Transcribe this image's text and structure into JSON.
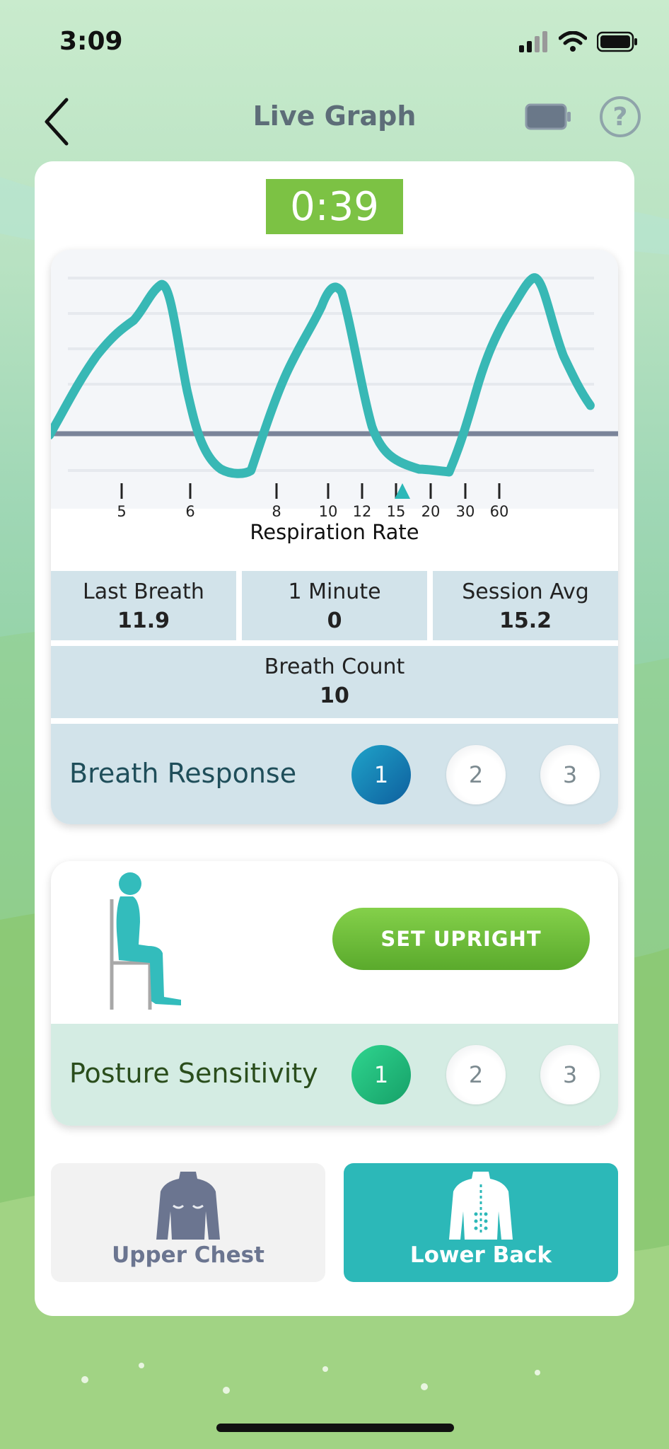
{
  "status_bar": {
    "time": "3:09"
  },
  "nav": {
    "title": "Live Graph",
    "help_glyph": "?"
  },
  "timer": "0:39",
  "graph": {
    "tick_labels": [
      "5",
      "6",
      "8",
      "10",
      "12",
      "15",
      "20",
      "30",
      "60"
    ],
    "axis_label": "Respiration Rate",
    "line_color": "#38b8b5",
    "baseline_color": "#7a8499"
  },
  "stats": {
    "last_breath": {
      "label": "Last Breath",
      "value": "11.9"
    },
    "one_minute": {
      "label": "1 Minute",
      "value": "0"
    },
    "session_avg": {
      "label": "Session Avg",
      "value": "15.2"
    },
    "breath_count": {
      "label": "Breath Count",
      "value": "10"
    }
  },
  "breath_response": {
    "label": "Breath Response",
    "options": [
      "1",
      "2",
      "3"
    ],
    "selected": "1"
  },
  "posture": {
    "button_label": "SET UPRIGHT",
    "sensitivity_label": "Posture Sensitivity",
    "options": [
      "1",
      "2",
      "3"
    ],
    "selected": "1"
  },
  "locations": {
    "upper_chest": "Upper Chest",
    "lower_back": "Lower Back",
    "selected": "Lower Back"
  },
  "colors": {
    "accent_teal": "#2cb8b8",
    "timer_green": "#7cc244",
    "set_button_green": "#6cbd38",
    "stat_bg": "#d2e3ea",
    "sensitivity_bg": "#d4ece3"
  }
}
